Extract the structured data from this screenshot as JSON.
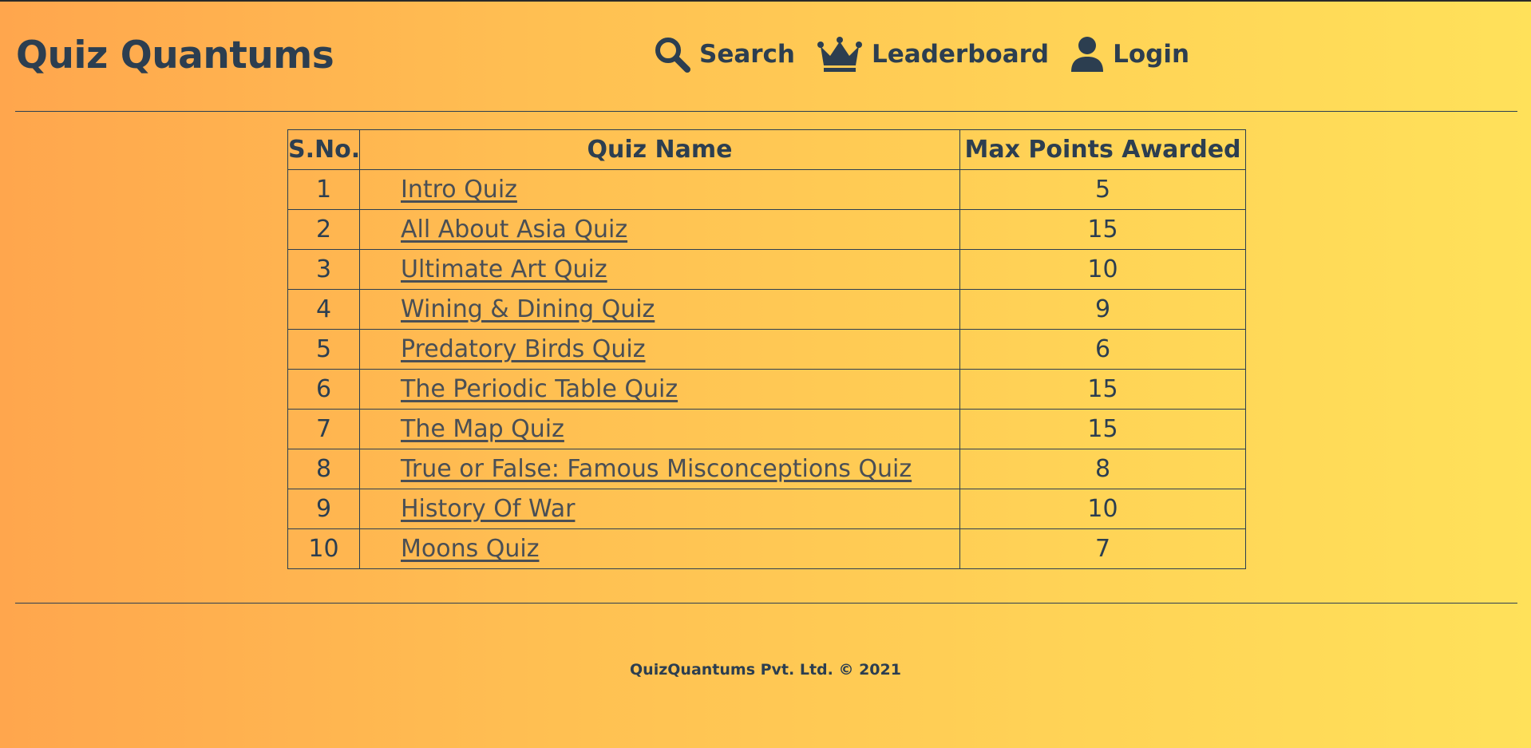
{
  "header": {
    "logo": "Quiz Quantums",
    "nav": [
      {
        "label": "Search",
        "icon": "search-icon"
      },
      {
        "label": "Leaderboard",
        "icon": "crown-icon"
      },
      {
        "label": "Login",
        "icon": "user-icon"
      }
    ]
  },
  "table": {
    "headers": [
      "S.No.",
      "Quiz Name",
      "Max Points Awarded"
    ],
    "rows": [
      {
        "sno": "1",
        "name": "Intro Quiz",
        "points": "5"
      },
      {
        "sno": "2",
        "name": "All About Asia Quiz",
        "points": "15"
      },
      {
        "sno": "3",
        "name": "Ultimate Art Quiz",
        "points": "10"
      },
      {
        "sno": "4",
        "name": "Wining & Dining Quiz",
        "points": "9"
      },
      {
        "sno": "5",
        "name": "Predatory Birds Quiz",
        "points": "6"
      },
      {
        "sno": "6",
        "name": "The Periodic Table Quiz",
        "points": "15"
      },
      {
        "sno": "7",
        "name": "The Map Quiz",
        "points": "15"
      },
      {
        "sno": "8",
        "name": "True or False: Famous Misconceptions Quiz",
        "points": "8"
      },
      {
        "sno": "9",
        "name": "History Of War",
        "points": "10"
      },
      {
        "sno": "10",
        "name": "Moons Quiz",
        "points": "7"
      }
    ]
  },
  "footer": {
    "text": "QuizQuantums Pvt. Ltd. © 2021"
  },
  "colors": {
    "text": "#2c3e50",
    "gradient_start": "#ffa64d",
    "gradient_end": "#ffe15a",
    "link": "#4a4f55"
  }
}
